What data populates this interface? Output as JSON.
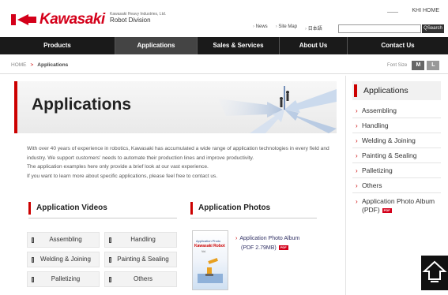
{
  "header": {
    "logo": "Kawasaki",
    "corp_small": "Kawasaki Heavy Industries, Ltd.",
    "division": "Robot Division",
    "khi_home": "KHI HOME",
    "links": [
      "News",
      "Site Map",
      "日本語"
    ],
    "search_placeholder": "",
    "search_button": "Search"
  },
  "nav": {
    "items": [
      "Products",
      "Applications",
      "Sales & Services",
      "About Us",
      "Contact Us"
    ],
    "active": "Applications"
  },
  "breadcrumb": {
    "home": "HOME",
    "separator": ">",
    "current": "Applications"
  },
  "fontsize": {
    "label": "Font Size",
    "m": "M",
    "l": "L"
  },
  "hero": {
    "title": "Applications"
  },
  "intro": [
    "With over 40 years of experience in robotics, Kawasaki has accumulated a wide range of application technologies in every field and industry. We support customers' needs to automate their production lines and improve productivity.",
    "The application examples here only provide a brief look at our vast experience.",
    "If you want to learn more about specific applications, please feel free to contact us."
  ],
  "videos": {
    "heading": "Application Videos",
    "buttons": [
      "Assembling",
      "Handling",
      "Welding & Joining",
      "Painting & Sealing",
      "Palletizing",
      "Others"
    ]
  },
  "photos": {
    "heading": "Application Photos",
    "booklet_line1": "Application Photo",
    "booklet_brand": "Kawasaki Robot",
    "booklet_line3": "Vol.",
    "album_line1": "Application Photo Album",
    "album_line2": "(PDF 2.79MB)",
    "pdf_badge": "PDF"
  },
  "sidebar": {
    "heading": "Applications",
    "items": [
      "Assembling",
      "Handling",
      "Welding & Joining",
      "Painting & Sealing",
      "Palletizing",
      "Others",
      "Application Photo Album (PDF)"
    ],
    "pdf_badge": "PDF"
  },
  "colors": {
    "accent": "#d4001a",
    "nav_bg": "#1a1a1a"
  },
  "icons": {
    "scroll_top": "up-arrow-icon"
  }
}
